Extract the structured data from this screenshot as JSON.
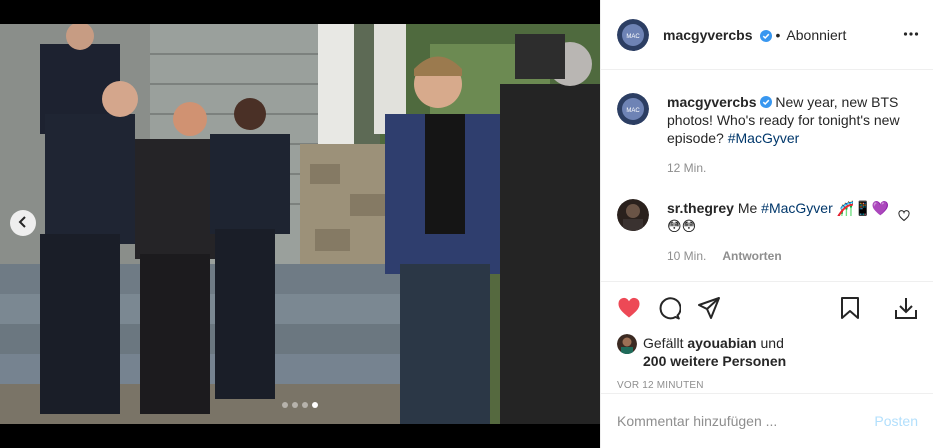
{
  "post": {
    "account": "macgyvercbs",
    "follow_status": "Abonniert",
    "separator": "•",
    "caption_lines": [
      "New year, new BTS",
      "photos! Who's ready for tonight's new",
      "episode?"
    ],
    "caption_hashtag": "#MacGyver",
    "caption_time": "12 Min.",
    "carousel_dots": 4,
    "carousel_active": 3
  },
  "comment": {
    "user": "sr.thegrey",
    "text": "Me",
    "hashtag": "#MacGyver",
    "emojis_line1": "🎢📱💜",
    "emojis_line2": "😳😳",
    "time": "10 Min.",
    "reply_label": "Antworten"
  },
  "likes": {
    "prefix": "Gefällt",
    "user": "ayouabian",
    "connector": "und",
    "others": "200 weitere Personen"
  },
  "timestamp": "VOR 12 MINUTEN",
  "add_comment": {
    "placeholder": "Kommentar hinzufügen ...",
    "post_label": "Posten"
  },
  "colors": {
    "heart_liked": "#ed4956",
    "verified": "#3897f0",
    "hashtag": "#00376b",
    "muted": "#8e8e8e",
    "post_disabled": "#b2dffc"
  },
  "icons": [
    "chevron-left-icon",
    "more-horizontal-icon",
    "verified-badge-icon",
    "heart-filled-icon",
    "comment-icon",
    "share-icon",
    "bookmark-icon",
    "download-icon",
    "heart-outline-icon"
  ]
}
